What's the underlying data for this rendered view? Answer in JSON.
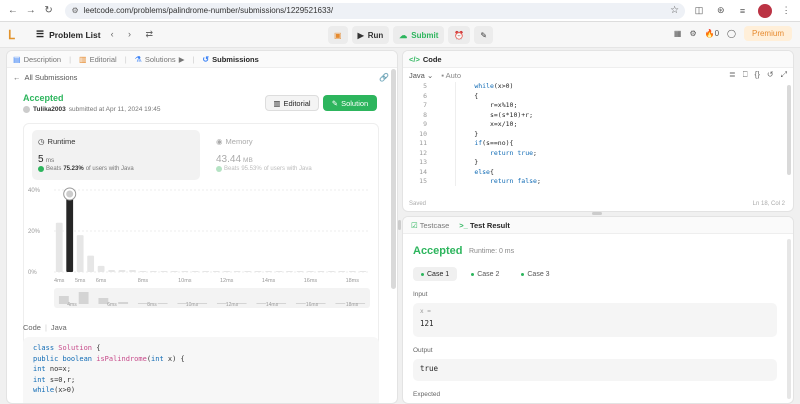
{
  "browser": {
    "url": "leetcode.com/problems/palindrome-number/submissions/1229521633/"
  },
  "topbar": {
    "problem_list": "Problem List",
    "run": "Run",
    "submit": "Submit",
    "streak": "0",
    "premium": "Premium"
  },
  "left_tabs": [
    {
      "label": "Description"
    },
    {
      "label": "Editorial"
    },
    {
      "label": "Solutions"
    },
    {
      "label": "Submissions"
    }
  ],
  "submission": {
    "back": "All Submissions",
    "status": "Accepted",
    "user": "Tulika2003",
    "submitted": "submitted at Apr 11, 2024 19:45",
    "editorial_btn": "Editorial",
    "solution_btn": "Solution",
    "runtime_label": "Runtime",
    "runtime_value": "5",
    "runtime_unit": "ms",
    "runtime_beats_pre": "Beats",
    "runtime_beats": "75.23%",
    "runtime_beats_post": "of users with Java",
    "memory_label": "Memory",
    "memory_value": "43.44",
    "memory_unit": "MB",
    "memory_beats_pre": "Beats",
    "memory_beats": "95.53%",
    "memory_beats_post": "of users with Java",
    "code_label": "Code",
    "code_lang": "Java"
  },
  "chart_data": {
    "type": "bar",
    "categories": [
      "4ms",
      "",
      "5ms",
      "",
      "6ms",
      "",
      "",
      "",
      "8ms",
      "",
      "",
      "",
      "10ms",
      "",
      "",
      "",
      "12ms",
      "",
      "",
      "",
      "14ms",
      "",
      "",
      "",
      "16ms",
      "",
      "",
      "",
      "18ms",
      ""
    ],
    "values": [
      24,
      40,
      18,
      8,
      3,
      1,
      1,
      1,
      0.5,
      0.5,
      0.5,
      0.5,
      0.5,
      0.5,
      0.5,
      0.5,
      0.5,
      0.5,
      0.5,
      0.5,
      0.5,
      0.5,
      0.5,
      0.5,
      0.5,
      0.5,
      0.5,
      0.5,
      0.5,
      0.5
    ],
    "highlight_index": 1,
    "y_ticks": [
      "40%",
      "20%",
      "0%"
    ],
    "ylim": [
      0,
      40
    ],
    "x_tick_labels": [
      "4ms",
      "6ms",
      "8ms",
      "10ms",
      "12ms",
      "14ms",
      "16ms",
      "18ms"
    ],
    "overview_values": [
      4,
      6,
      3,
      1,
      0.5,
      0.5,
      0.5,
      0.5,
      0.5,
      0.5,
      0.5,
      0.5,
      0.5,
      0.5,
      0.5,
      0.5
    ],
    "grid": true
  },
  "left_code": [
    "class Solution {",
    "    public boolean isPalindrome(int x) {",
    "        int no=x;",
    "        int s=0,r;",
    "        while(x>0)"
  ],
  "right_top": {
    "title": "Code",
    "language": "Java",
    "mode": "Auto",
    "saved": "Saved",
    "position": "Ln 18, Col 2",
    "line_numbers": [
      "5",
      "6",
      "7",
      "8",
      "9",
      "10",
      "11",
      "12",
      "13",
      "14",
      "15"
    ],
    "lines": [
      "        while(x>0)",
      "        {",
      "            r=x%10;",
      "            s=(s*10)+r;",
      "            x=x/10;",
      "        }",
      "        if(s==no){",
      "            return true;",
      "        }",
      "        else{",
      "            return false;"
    ]
  },
  "result": {
    "tab_testcase": "Testcase",
    "tab_result": "Test Result",
    "status": "Accepted",
    "runtime": "Runtime: 0 ms",
    "cases": [
      "Case 1",
      "Case 2",
      "Case 3"
    ],
    "input_label": "Input",
    "input_var": "x =",
    "input_value": "121",
    "output_label": "Output",
    "output_value": "true",
    "expected_label": "Expected"
  }
}
